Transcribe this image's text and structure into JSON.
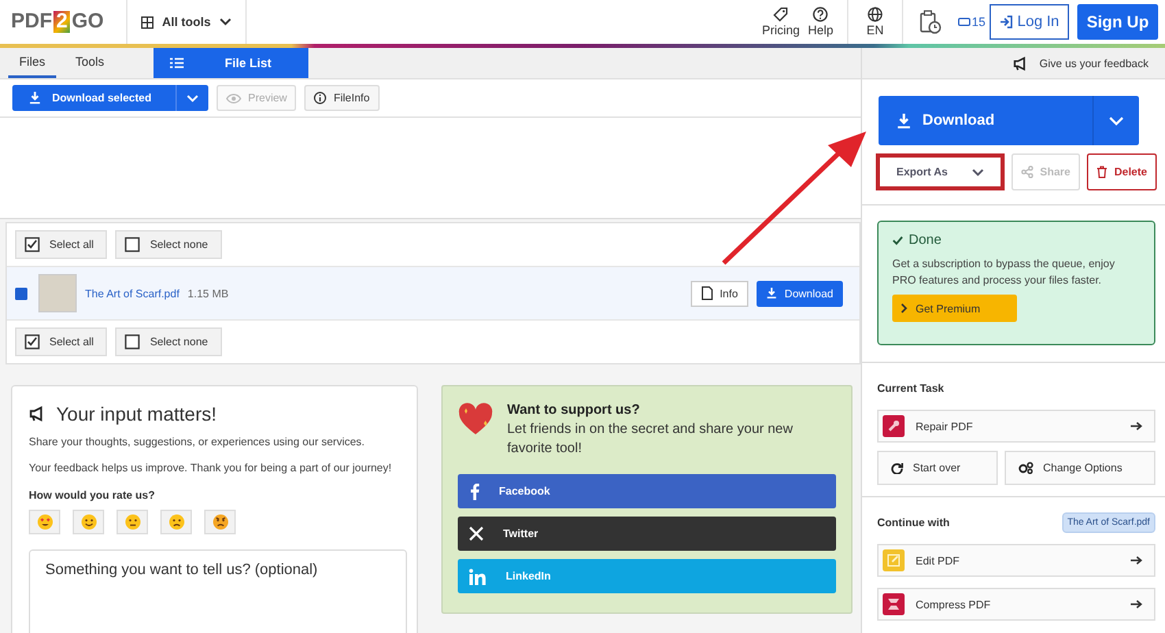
{
  "header": {
    "logo": [
      "PDF",
      "2",
      "GO"
    ],
    "tools_menu": "All tools",
    "links": [
      {
        "label": "Pricing",
        "kind": "pricing"
      },
      {
        "label": "Help",
        "kind": "help"
      }
    ],
    "language": "EN",
    "credits": "15",
    "login": "Log In",
    "signup": "Sign Up"
  },
  "tabs": [
    {
      "label": "Files",
      "selected": true
    },
    {
      "label": "Tools",
      "selected": false
    }
  ],
  "view_tab": {
    "label": "File List",
    "selected": true
  },
  "toolbar": {
    "download_selected": "Download selected",
    "buttons": [
      {
        "label": "Preview",
        "kind": "preview",
        "disabled": true
      },
      {
        "label": "FileInfo",
        "kind": "info",
        "disabled": false
      }
    ]
  },
  "select_top": [
    {
      "label": "Select all",
      "kind": "all"
    },
    {
      "label": "Select none",
      "kind": "none"
    }
  ],
  "files": [
    {
      "name": "The Art of Scarf.pdf",
      "size": "1.15 MB",
      "checked": true,
      "info": "Info",
      "download": "Download"
    }
  ],
  "select_bottom": [
    {
      "label": "Select all",
      "kind": "all"
    },
    {
      "label": "Select none",
      "kind": "none"
    }
  ],
  "feedback": {
    "title": "Your input matters!",
    "paragraphs": [
      "Share your thoughts, suggestions, or experiences using our services.",
      "Your feedback helps us improve. Thank you for being a part of our journey!"
    ],
    "rating_label": "How would you rate us?",
    "ratings": [
      {
        "kind": "love"
      },
      {
        "kind": "happy"
      },
      {
        "kind": "neutral"
      },
      {
        "kind": "sad"
      },
      {
        "kind": "angry"
      }
    ],
    "message_placeholder": "Something you want to tell us? (optional)"
  },
  "support": {
    "title": "Want to support us?",
    "text": "Let friends in on the secret and share your new favorite tool!",
    "shares": [
      {
        "label": "Facebook",
        "kind": "facebook",
        "color": "#3b63c4"
      },
      {
        "label": "Twitter",
        "kind": "x",
        "color": "#333333"
      },
      {
        "label": "LinkedIn",
        "kind": "linkedin",
        "color": "#0ea5e0"
      }
    ]
  },
  "sidebar": {
    "feedback_link": "Give us your feedback",
    "download": "Download",
    "actions": [
      {
        "label": "Export As",
        "kind": "export",
        "highlighted": true,
        "disabled": false
      },
      {
        "label": "Share",
        "kind": "share",
        "highlighted": false,
        "disabled": true
      },
      {
        "label": "Delete",
        "kind": "delete",
        "highlighted": false,
        "disabled": false
      }
    ],
    "status": {
      "title": "Done",
      "text": "Get a subscription to bypass the queue, enjoy PRO features and process your files faster.",
      "button": "Get Premium"
    },
    "current_task": {
      "heading": "Current Task",
      "task": {
        "label": "Repair PDF",
        "kind": "repair"
      },
      "buttons": [
        {
          "label": "Start over",
          "kind": "restart"
        },
        {
          "label": "Change Options",
          "kind": "options"
        }
      ]
    },
    "continue": {
      "heading": "Continue with",
      "file": "The Art of Scarf.pdf",
      "tools": [
        {
          "label": "Edit PDF",
          "kind": "edit"
        },
        {
          "label": "Compress PDF",
          "kind": "compress"
        }
      ]
    }
  }
}
